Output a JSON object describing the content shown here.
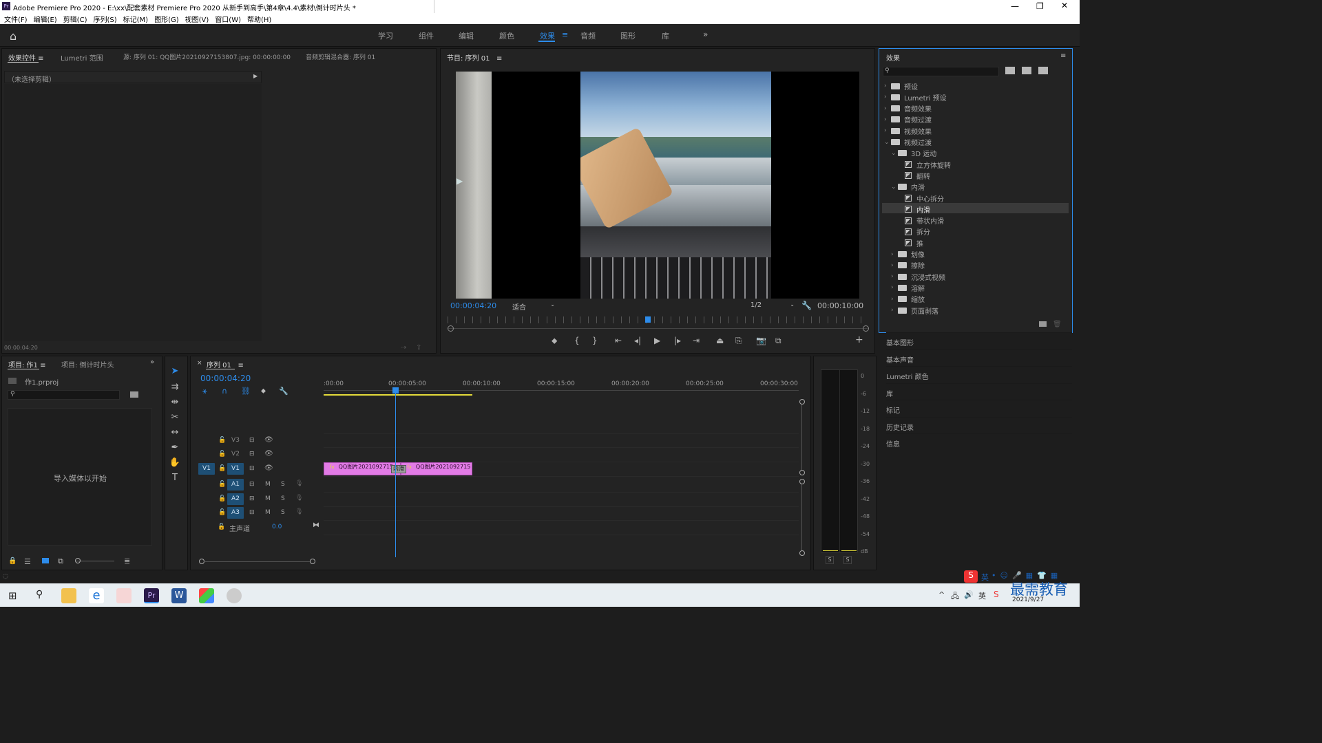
{
  "window": {
    "title": "Adobe Premiere Pro 2020 - E:\\xx\\配套素材 Premiere Pro 2020 从新手到高手\\第4章\\4.4\\素材\\倒计时片头 *",
    "app_icon": "Pr"
  },
  "menu": [
    "文件(F)",
    "编辑(E)",
    "剪辑(C)",
    "序列(S)",
    "标记(M)",
    "图形(G)",
    "视图(V)",
    "窗口(W)",
    "帮助(H)"
  ],
  "workspaces": [
    "学习",
    "组件",
    "编辑",
    "颜色",
    "效果",
    "音频",
    "图形",
    "库"
  ],
  "active_workspace": "效果",
  "source_panel": {
    "tabs": [
      "效果控件",
      "Lumetri 范围",
      "源: 序列 01: QQ图片20210927153807.jpg: 00:00:00:00",
      "音频剪辑混合器: 序列 01"
    ],
    "no_clip": "（未选择剪辑）",
    "timecode": "00:00:04:20"
  },
  "program": {
    "tab": "节目: 序列 01",
    "timecode": "00:00:04:20",
    "fit": "适合",
    "quality": "1/2",
    "duration": "00:00:10:00"
  },
  "effects": {
    "title": "效果",
    "search_placeholder": "",
    "tree": [
      {
        "label": "预设",
        "level": 0,
        "kind": "folder-star",
        "open": false
      },
      {
        "label": "Lumetri 预设",
        "level": 0,
        "kind": "folder-star",
        "open": false
      },
      {
        "label": "音频效果",
        "level": 0,
        "kind": "folder",
        "open": false
      },
      {
        "label": "音频过渡",
        "level": 0,
        "kind": "folder",
        "open": false
      },
      {
        "label": "视频效果",
        "level": 0,
        "kind": "folder",
        "open": false
      },
      {
        "label": "视频过渡",
        "level": 0,
        "kind": "folder",
        "open": true
      },
      {
        "label": "3D 运动",
        "level": 1,
        "kind": "folder",
        "open": true
      },
      {
        "label": "立方体旋转",
        "level": 2,
        "kind": "effect"
      },
      {
        "label": "翻转",
        "level": 2,
        "kind": "effect"
      },
      {
        "label": "内滑",
        "level": 1,
        "kind": "folder",
        "open": true
      },
      {
        "label": "中心拆分",
        "level": 2,
        "kind": "effect"
      },
      {
        "label": "内滑",
        "level": 2,
        "kind": "effect",
        "selected": true
      },
      {
        "label": "带状内滑",
        "level": 2,
        "kind": "effect"
      },
      {
        "label": "拆分",
        "level": 2,
        "kind": "effect"
      },
      {
        "label": "推",
        "level": 2,
        "kind": "effect"
      },
      {
        "label": "划像",
        "level": 1,
        "kind": "folder",
        "open": false
      },
      {
        "label": "擦除",
        "level": 1,
        "kind": "folder",
        "open": false
      },
      {
        "label": "沉浸式视频",
        "level": 1,
        "kind": "folder",
        "open": false
      },
      {
        "label": "溶解",
        "level": 1,
        "kind": "folder",
        "open": false
      },
      {
        "label": "缩放",
        "level": 1,
        "kind": "folder",
        "open": false
      },
      {
        "label": "页面剥落",
        "level": 1,
        "kind": "folder",
        "open": false
      }
    ],
    "sections": [
      "基本图形",
      "基本声音",
      "Lumetri 颜色",
      "库",
      "标记",
      "历史记录",
      "信息"
    ]
  },
  "project": {
    "tabs": [
      "项目: 作1",
      "项目: 倒计时片头"
    ],
    "file": "作1.prproj",
    "empty_hint": "导入媒体以开始"
  },
  "timeline": {
    "tab": "序列 01",
    "timecode": "00:00:04:20",
    "ruler": [
      ":00:00",
      "00:00:05:00",
      "00:00:10:00",
      "00:00:15:00",
      "00:00:20:00",
      "00:00:25:00",
      "00:00:30:00"
    ],
    "tracks_video": [
      "V3",
      "V2",
      "V1"
    ],
    "tracks_audio": [
      "A1",
      "A2",
      "A3"
    ],
    "source_patch": "V1",
    "master": {
      "label": "主声道",
      "value": "0.0"
    },
    "clips": [
      {
        "label": "QQ图片2021092715",
        "track": "V1",
        "start": 0,
        "end": 5.2
      },
      {
        "label": "QQ图片2021092715",
        "track": "V1",
        "start": 5.2,
        "end": 10
      }
    ],
    "transition_label": "内滑",
    "playhead_seconds": 4.8,
    "timecode_scale_max": 30,
    "m_label": "M",
    "s_label": "S"
  },
  "meter": {
    "labels": [
      "0",
      "-6",
      "-12",
      "-18",
      "-24",
      "-30",
      "-36",
      "-42",
      "-48",
      "-54",
      "dB"
    ],
    "s_buttons": [
      "S",
      "S"
    ]
  },
  "taskbar": {
    "date": "2021/9/27",
    "ime": "英",
    "watermark": "最需教育"
  },
  "colors": {
    "accent": "#2d8ceb",
    "clip": "#e27be6",
    "selection": "#3a3a3a",
    "yellow": "#e5dc3a"
  }
}
